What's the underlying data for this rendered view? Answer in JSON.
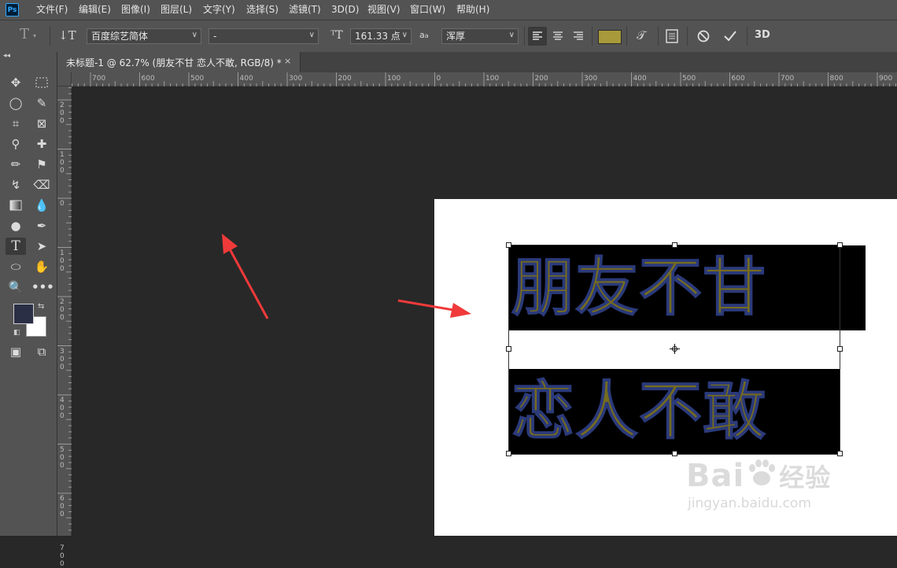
{
  "app": {
    "logo": "Ps"
  },
  "menu": [
    "文件(F)",
    "编辑(E)",
    "图像(I)",
    "图层(L)",
    "文字(Y)",
    "选择(S)",
    "滤镜(T)",
    "3D(D)",
    "视图(V)",
    "窗口(W)",
    "帮助(H)"
  ],
  "options": {
    "font_family": "百度综艺简体",
    "font_style": "-",
    "font_size": "161.33 点",
    "antialias_label": "a",
    "antialias_sub": "a",
    "antialias": "浑厚",
    "three_d": "3D",
    "text_color": "#a89a3a"
  },
  "doc_tab": {
    "title": "未标题-1 @ 62.7% (朋友不甘 恋人不敢, RGB/8) *",
    "close": "×"
  },
  "ruler_h": [
    "700",
    "600",
    "500",
    "400",
    "300",
    "200",
    "100",
    "0",
    "100",
    "200",
    "300",
    "400",
    "500",
    "600",
    "700",
    "800",
    "900"
  ],
  "ruler_v": [
    "200",
    "100",
    "0",
    "100",
    "200",
    "300",
    "400",
    "500",
    "600",
    "700"
  ],
  "canvas_text": {
    "line1": "朋友不甘",
    "line2": "恋人不敢"
  },
  "colors": {
    "foreground": "#2b2f45",
    "background": "#ffffff",
    "text_fill": "#756b1e",
    "arrow": "#f03a3a"
  },
  "watermark": {
    "brand": "Bai",
    "brand_end": "经验",
    "url": "jingyan.baidu.com"
  }
}
